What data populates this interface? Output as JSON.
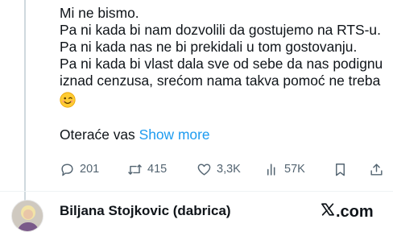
{
  "tweet": {
    "lines": [
      "Mi ne bismo.",
      "Pa ni kada bi nam dozvolili da gostujemo na RTS-u.",
      "Pa ni kada nas ne bi prekidali u tom gostovanju.",
      "Pa ni kada bi vlast dala sve od sebe da nas podignu",
      "iznad cenzusa, srećom nama takva pomoć ne treba"
    ],
    "emoji": "winking-face-emoji",
    "truncated_text": "Oteraće vas",
    "show_more": "Show more"
  },
  "actions": {
    "replies": "201",
    "reposts": "415",
    "likes": "3,3K",
    "views": "57K"
  },
  "footer": {
    "author_name": "Biljana Stojkovic (dabrica)",
    "brand": ".com"
  },
  "colors": {
    "text": "#0f1419",
    "secondary": "#536471",
    "link": "#1d9bf0",
    "thread_line": "#cfd9de"
  },
  "icons": [
    "reply-icon",
    "repost-icon",
    "like-icon",
    "views-icon",
    "bookmark-icon",
    "share-icon",
    "x-logo-icon"
  ]
}
